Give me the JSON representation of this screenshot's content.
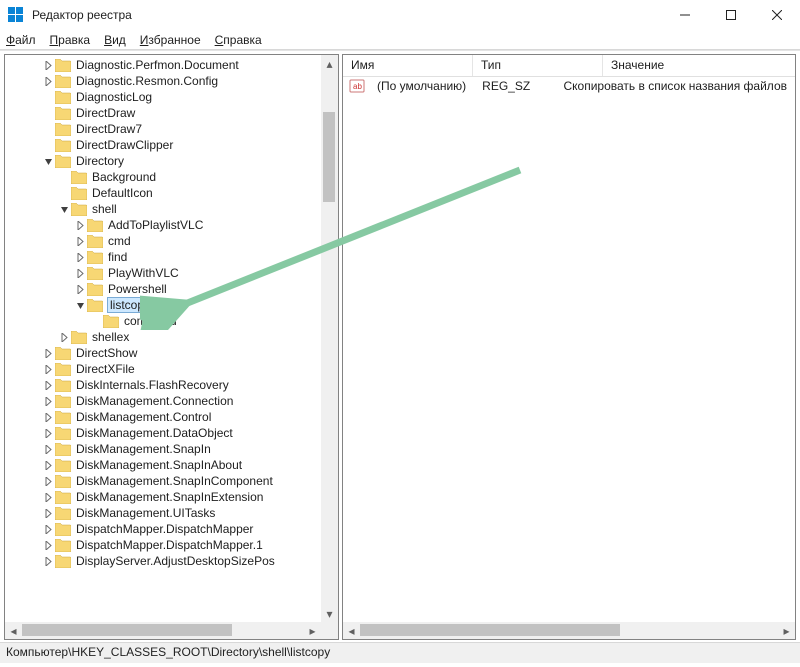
{
  "window": {
    "title": "Редактор реестра"
  },
  "menu": {
    "file": "Файл",
    "file_u": "Ф",
    "file_rest": "айл",
    "edit_u": "П",
    "edit_rest": "равка",
    "view_u": "В",
    "view_rest": "ид",
    "fav_u": "И",
    "fav_rest": "збранное",
    "help_u": "С",
    "help_rest": "правка"
  },
  "tree": {
    "items": [
      {
        "indent": 2,
        "exp": ">",
        "label": "Diagnostic.Perfmon.Document"
      },
      {
        "indent": 2,
        "exp": ">",
        "label": "Diagnostic.Resmon.Config"
      },
      {
        "indent": 2,
        "exp": "",
        "label": "DiagnosticLog"
      },
      {
        "indent": 2,
        "exp": "",
        "label": "DirectDraw"
      },
      {
        "indent": 2,
        "exp": "",
        "label": "DirectDraw7"
      },
      {
        "indent": 2,
        "exp": "",
        "label": "DirectDrawClipper"
      },
      {
        "indent": 2,
        "exp": "v",
        "label": "Directory"
      },
      {
        "indent": 3,
        "exp": "",
        "label": "Background"
      },
      {
        "indent": 3,
        "exp": "",
        "label": "DefaultIcon"
      },
      {
        "indent": 3,
        "exp": "v",
        "label": "shell"
      },
      {
        "indent": 4,
        "exp": ">",
        "label": "AddToPlaylistVLC"
      },
      {
        "indent": 4,
        "exp": ">",
        "label": "cmd"
      },
      {
        "indent": 4,
        "exp": ">",
        "label": "find"
      },
      {
        "indent": 4,
        "exp": ">",
        "label": "PlayWithVLC"
      },
      {
        "indent": 4,
        "exp": ">",
        "label": "Powershell"
      },
      {
        "indent": 4,
        "exp": "v",
        "label": "listcopy",
        "editing": true
      },
      {
        "indent": 5,
        "exp": "",
        "label": "command"
      },
      {
        "indent": 3,
        "exp": ">",
        "label": "shellex"
      },
      {
        "indent": 2,
        "exp": ">",
        "label": "DirectShow"
      },
      {
        "indent": 2,
        "exp": ">",
        "label": "DirectXFile"
      },
      {
        "indent": 2,
        "exp": ">",
        "label": "DiskInternals.FlashRecovery"
      },
      {
        "indent": 2,
        "exp": ">",
        "label": "DiskManagement.Connection"
      },
      {
        "indent": 2,
        "exp": ">",
        "label": "DiskManagement.Control"
      },
      {
        "indent": 2,
        "exp": ">",
        "label": "DiskManagement.DataObject"
      },
      {
        "indent": 2,
        "exp": ">",
        "label": "DiskManagement.SnapIn"
      },
      {
        "indent": 2,
        "exp": ">",
        "label": "DiskManagement.SnapInAbout"
      },
      {
        "indent": 2,
        "exp": ">",
        "label": "DiskManagement.SnapInComponent"
      },
      {
        "indent": 2,
        "exp": ">",
        "label": "DiskManagement.SnapInExtension"
      },
      {
        "indent": 2,
        "exp": ">",
        "label": "DiskManagement.UITasks"
      },
      {
        "indent": 2,
        "exp": ">",
        "label": "DispatchMapper.DispatchMapper"
      },
      {
        "indent": 2,
        "exp": ">",
        "label": "DispatchMapper.DispatchMapper.1"
      },
      {
        "indent": 2,
        "exp": ">",
        "label": "DisplayServer.AdjustDesktopSizePos"
      }
    ]
  },
  "list": {
    "columns": {
      "name": "Имя",
      "type": "Тип",
      "value": "Значение"
    },
    "col_widths": {
      "name": 130,
      "type": 130,
      "value": 200
    },
    "rows": [
      {
        "name": "(По умолчанию)",
        "type": "REG_SZ",
        "value": "Скопировать в список названия файлов"
      }
    ]
  },
  "status": {
    "path": "Компьютер\\HKEY_CLASSES_ROOT\\Directory\\shell\\listcopy"
  },
  "arrow": {
    "color": "#86c9a2"
  }
}
